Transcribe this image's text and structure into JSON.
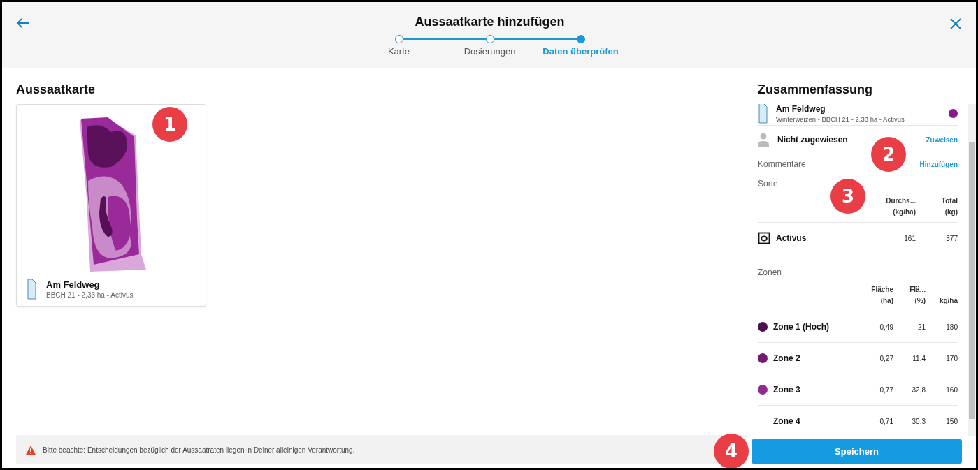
{
  "header": {
    "title": "Aussaatkarte hinzufügen",
    "steps": [
      {
        "label": "Karte",
        "selected": false
      },
      {
        "label": "Dosierungen",
        "selected": false
      },
      {
        "label": "Daten überprüfen",
        "selected": true
      }
    ]
  },
  "main": {
    "title": "Aussaatkarte",
    "card": {
      "name": "Am Feldweg",
      "details": "BBCH 21 - 2,33 ha - Activus"
    },
    "notice": "Bitte beachte: Entscheidungen bezüglich der Aussaatraten liegen in Deiner alleinigen Verantwortung."
  },
  "summary": {
    "title": "Zusammenfassung",
    "field": {
      "name": "Am Feldweg",
      "details": "Winterweizen - BBCH 21 - 2,33 ha - Activus",
      "color": "#8b1a8b"
    },
    "assignee": {
      "label": "Nicht zugewiesen",
      "action": "Zuweisen"
    },
    "comments": {
      "label": "Kommentare",
      "action": "Hinzufügen"
    },
    "variety": {
      "label": "Sorte",
      "columns": [
        [
          "Durchs...",
          "(kg/ha)"
        ],
        [
          "Total",
          "(kg)"
        ]
      ],
      "rows": [
        {
          "name": "Activus",
          "values": [
            "161",
            "377"
          ]
        }
      ]
    },
    "zones": {
      "label": "Zonen",
      "columns": [
        [
          "Fläche",
          "(ha)"
        ],
        [
          "Flä...",
          "(%)"
        ],
        [
          "kg/ha"
        ]
      ],
      "rows": [
        {
          "name": "Zone 1 (Hoch)",
          "color": "#4f0f4f",
          "values": [
            "0,49",
            "21",
            "180"
          ]
        },
        {
          "name": "Zone 2",
          "color": "#701a70",
          "values": [
            "0,27",
            "11,4",
            "170"
          ]
        },
        {
          "name": "Zone 3",
          "color": "#922a92",
          "values": [
            "0,77",
            "32,8",
            "160"
          ]
        },
        {
          "name": "Zone 4",
          "values": [
            "0,71",
            "30,3",
            "150"
          ]
        }
      ]
    },
    "save": "Speichern"
  },
  "callouts": [
    "1",
    "2",
    "3",
    "4"
  ]
}
